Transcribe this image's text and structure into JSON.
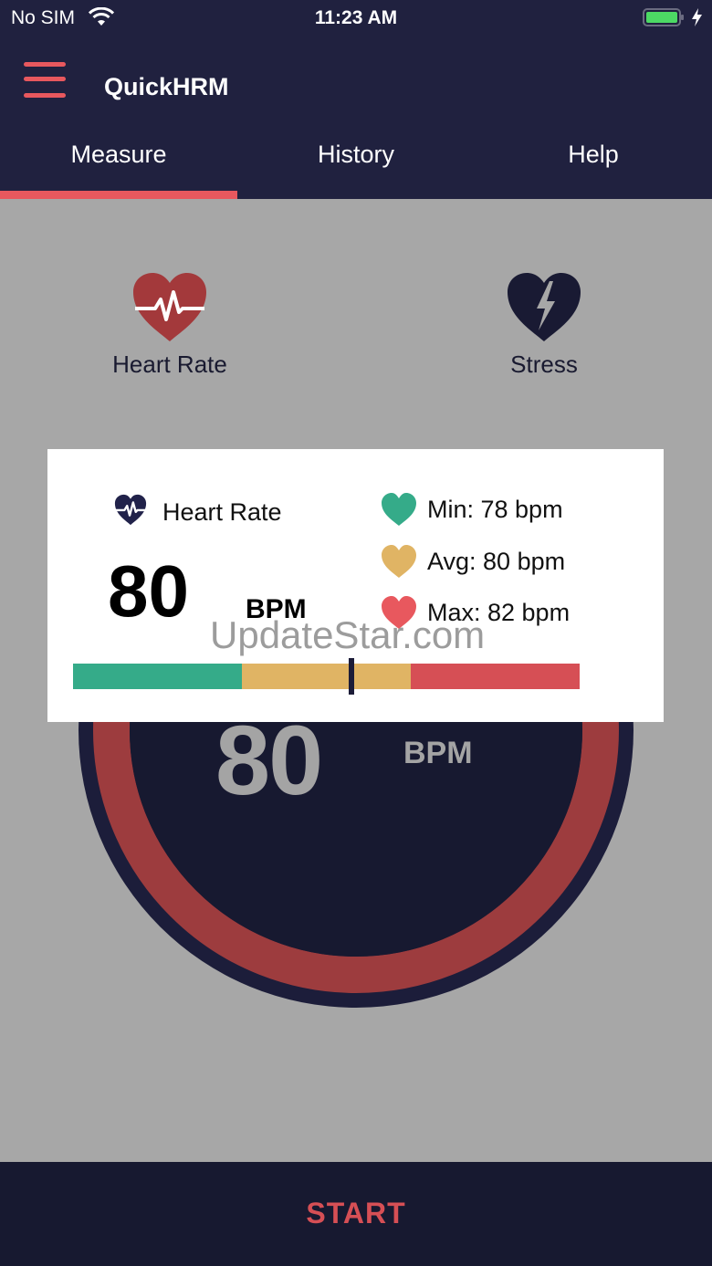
{
  "status_bar": {
    "carrier": "No SIM",
    "time": "11:23 AM",
    "wifi_icon": "wifi-icon",
    "battery_icon": "battery-full-icon",
    "charging_icon": "charging-bolt-icon"
  },
  "header": {
    "menu_icon": "hamburger-menu-icon",
    "title": "QuickHRM"
  },
  "tabs": [
    {
      "label": "Measure",
      "active": true
    },
    {
      "label": "History",
      "active": false
    },
    {
      "label": "Help",
      "active": false
    }
  ],
  "modes": {
    "heart_rate": {
      "label": "Heart Rate",
      "icon": "heart-pulse-icon"
    },
    "stress": {
      "label": "Stress",
      "icon": "broken-heart-icon"
    }
  },
  "gauge": {
    "value": "80",
    "unit": "BPM"
  },
  "result_card": {
    "title": "Heart Rate",
    "value": "80",
    "unit": "BPM",
    "min_label": "Min: 78 bpm",
    "avg_label": "Avg: 80 bpm",
    "max_label": "Max: 82 bpm",
    "scale_position": 0.55
  },
  "watermark": "UpdateStar.com",
  "footer": {
    "start_label": "START"
  },
  "colors": {
    "header_bg": "#20213f",
    "accent": "#e8585e",
    "low": "#35ab89",
    "mid": "#e0b464",
    "high": "#d64f55",
    "gauge_ring": "#9d3c3e",
    "gauge_inner": "#171930"
  }
}
